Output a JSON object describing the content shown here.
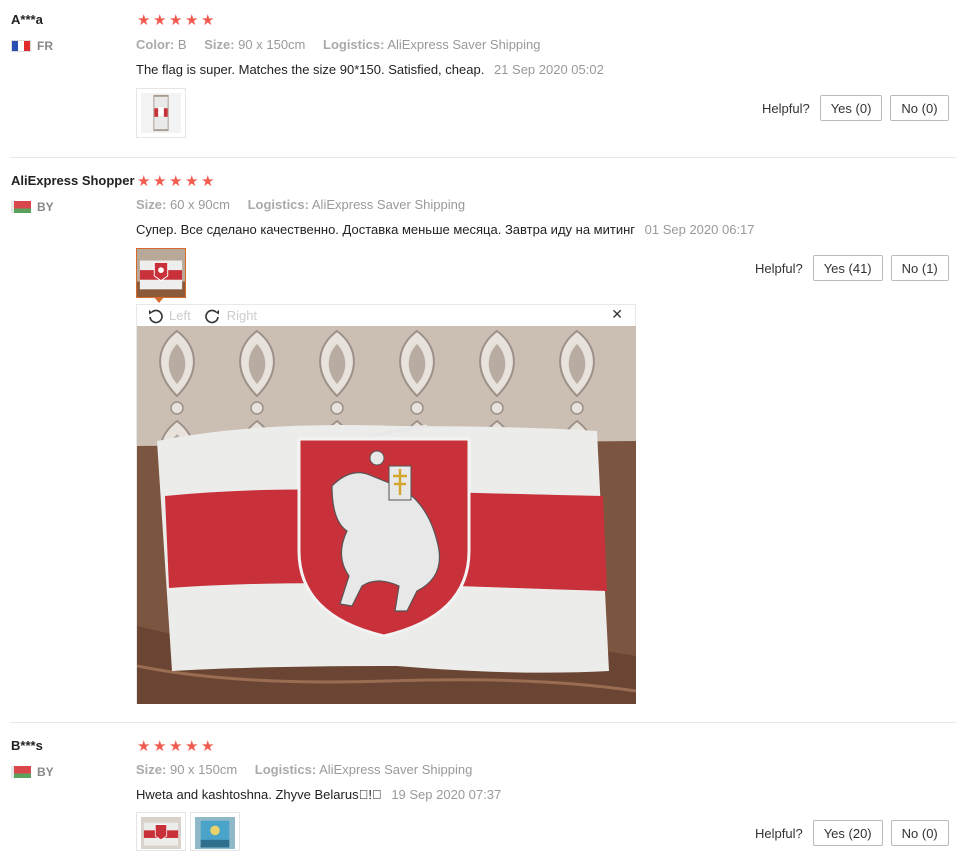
{
  "reviews": [
    {
      "user": "A***a",
      "country": "FR",
      "rating": 5,
      "attrs": [
        {
          "key": "Color:",
          "value": "B"
        },
        {
          "key": "Size:",
          "value": "90 x 150cm"
        },
        {
          "key": "Logistics:",
          "value": "AliExpress Saver Shipping"
        }
      ],
      "text": "The flag is super. Matches the size 90*150. Satisfied, cheap.",
      "date": "21 Sep 2020 05:02",
      "helpful_label": "Helpful?",
      "yes": "Yes (0)",
      "no": "No (0)"
    },
    {
      "user": "AliExpress Shopper",
      "country": "BY",
      "rating": 5,
      "attrs": [
        {
          "key": "Size:",
          "value": "60 x 90cm"
        },
        {
          "key": "Logistics:",
          "value": "AliExpress Saver Shipping"
        }
      ],
      "text": "Супер. Все сделано качественно. Доставка меньше месяца. Завтра иду на митинг",
      "date": "01 Sep 2020 06:17",
      "helpful_label": "Helpful?",
      "yes": "Yes (41)",
      "no": "No (1)"
    },
    {
      "user": "B***s",
      "country": "BY",
      "rating": 5,
      "attrs": [
        {
          "key": "Size:",
          "value": "90 x 150cm"
        },
        {
          "key": "Logistics:",
          "value": "AliExpress Saver Shipping"
        }
      ],
      "text": "Hweta and kashtoshna. Zhyve Belarus\u0000!\u0000",
      "date": "19 Sep 2020 07:37",
      "helpful_label": "Helpful?",
      "yes": "Yes (20)",
      "no": "No (0)"
    }
  ],
  "viewer": {
    "rotate_left": "Left",
    "rotate_right": "Right",
    "close_icon": "close-icon"
  },
  "colors": {
    "star": "#f15b50",
    "flag_red": "#c8303a",
    "muted": "#999999"
  }
}
